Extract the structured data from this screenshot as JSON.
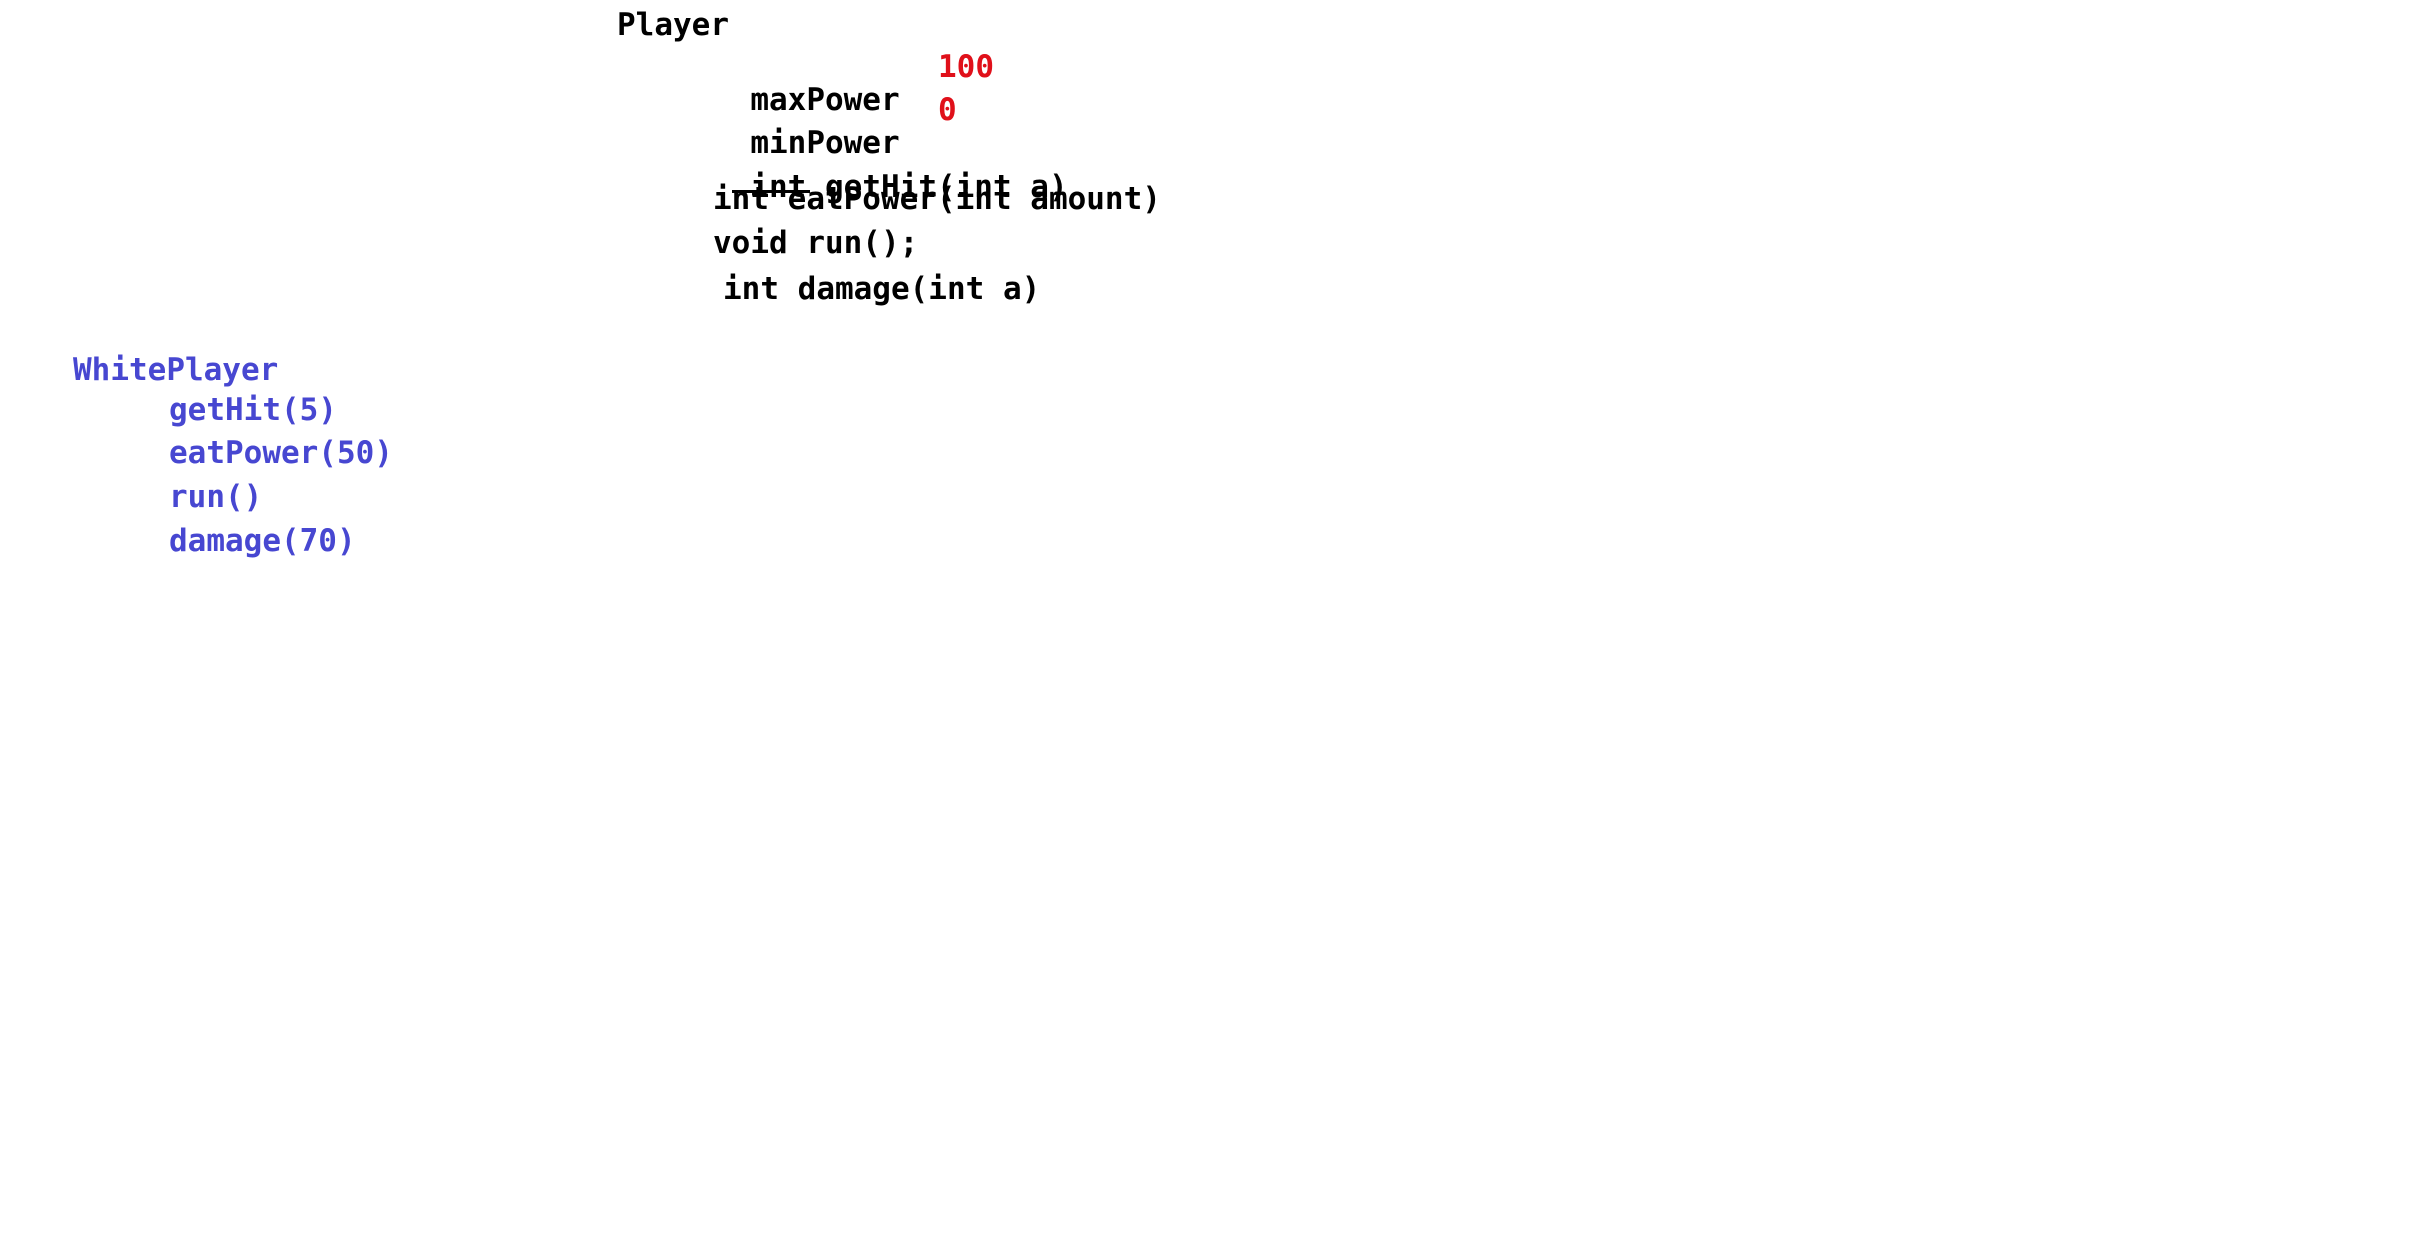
{
  "player": {
    "class_name": "Player",
    "fields": [
      {
        "name": "maxPower",
        "value": "100"
      },
      {
        "name": "minPower",
        "value": "0"
      }
    ],
    "methods": {
      "gethit_return_struck": "int",
      "gethit_sig": "getHit(int a)",
      "eatpower": "int eatPower(int amount)",
      "run": "void run();",
      "damage": "int damage(int a)"
    },
    "colors": {
      "text": "#000000",
      "value": "#e0101a"
    }
  },
  "white_player": {
    "class_name": "WhitePlayer",
    "calls": [
      "getHit(5)",
      "eatPower(50)",
      "run()",
      "damage(70)"
    ],
    "colors": {
      "text": "#4747d1"
    }
  }
}
